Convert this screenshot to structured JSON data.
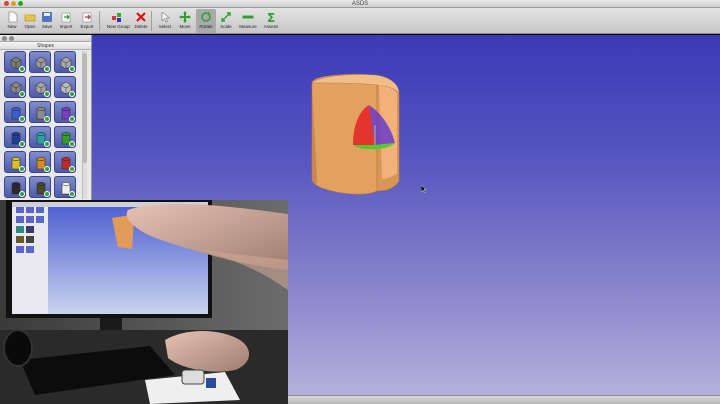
{
  "window": {
    "title": "ASDS"
  },
  "toolbar": {
    "buttons": [
      {
        "label": "New",
        "icon": "new-document-icon"
      },
      {
        "label": "Open",
        "icon": "folder-icon"
      },
      {
        "label": "Save",
        "icon": "save-disk-icon"
      },
      {
        "label": "Import",
        "icon": "import-icon"
      },
      {
        "label": "Export",
        "icon": "export-icon"
      },
      {
        "label": "New Group",
        "icon": "new-group-icon"
      },
      {
        "label": "Delete",
        "icon": "delete-x-icon"
      },
      {
        "label": "Select",
        "icon": "arrow-cursor-icon"
      },
      {
        "label": "Move",
        "icon": "move-arrows-icon"
      },
      {
        "label": "Rotate",
        "icon": "rotate-icon"
      },
      {
        "label": "Scale",
        "icon": "scale-icon"
      },
      {
        "label": "Measure",
        "icon": "ruler-icon"
      },
      {
        "label": "Assess",
        "icon": "sigma-icon"
      }
    ],
    "active": "Rotate"
  },
  "shapes_panel": {
    "title": "Shapes",
    "items": [
      "cube-shape-icon",
      "box-shape-icon",
      "slab-shape-icon",
      "wedge-shape-icon",
      "cylinder-shape-icon",
      "tube-shape-icon",
      "cylinder-blue-icon",
      "cylinder-grey-icon",
      "cylinder-purple-icon",
      "cylinder-navy-icon",
      "cylinder-teal-icon",
      "cylinder-green-icon",
      "cylinder-yellow-icon",
      "cylinder-orange-icon",
      "cylinder-red-icon",
      "cylinder-dark-icon",
      "cylinder-olive-icon",
      "cylinder-white-icon"
    ]
  },
  "colors": {
    "viewport_top": "#3c3ab8",
    "viewport_bottom": "#b3b1db",
    "model_color": "#e3a160",
    "toolbar_bg": "#d6d6d6"
  }
}
